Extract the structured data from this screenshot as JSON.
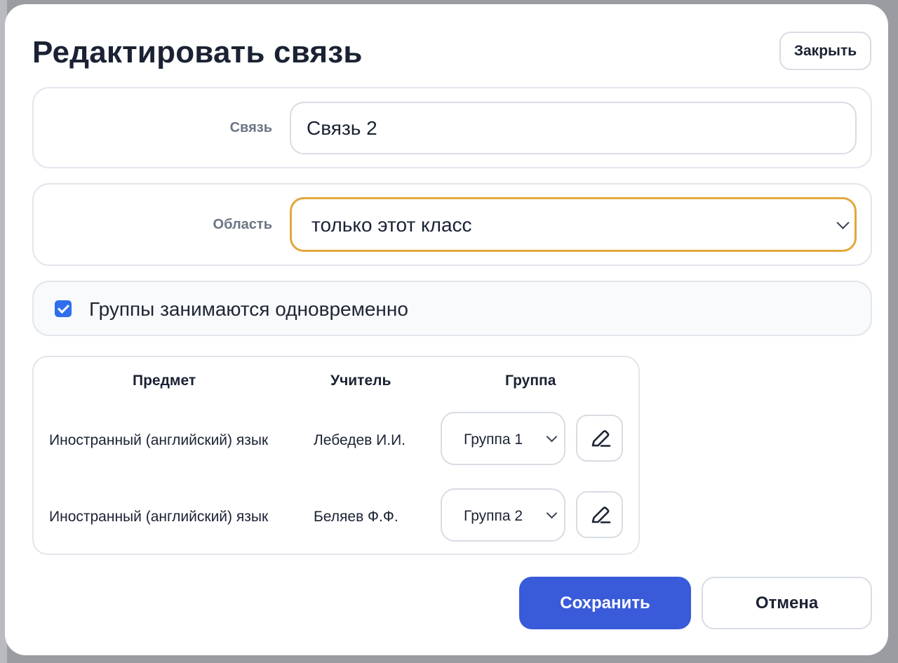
{
  "modal": {
    "title": "Редактировать связь",
    "close_label": "Закрыть"
  },
  "fields": {
    "link_label": "Связь",
    "link_value": "Связь 2",
    "area_label": "Область",
    "area_value": "только этот класс"
  },
  "checkbox": {
    "label": "Группы занимаются одновременно",
    "checked": true
  },
  "table": {
    "headers": {
      "subject": "Предмет",
      "teacher": "Учитель",
      "group": "Группа"
    },
    "rows": [
      {
        "subject": "Иностранный (английский) язык",
        "teacher": "Лебедев И.И.",
        "group": "Группа 1"
      },
      {
        "subject": "Иностранный (английский) язык",
        "teacher": "Беляев Ф.Ф.",
        "group": "Группа 2"
      }
    ]
  },
  "actions": {
    "save_label": "Сохранить",
    "cancel_label": "Отмена"
  },
  "icons": {
    "row_edit": "pencil-icon",
    "select_arrow": "chevron-down-icon",
    "checkbox_mark": "checkmark-icon"
  },
  "colors": {
    "accent": "#3a5bd9",
    "focus_border": "#e2a73d",
    "checkbox": "#2f6fec"
  }
}
